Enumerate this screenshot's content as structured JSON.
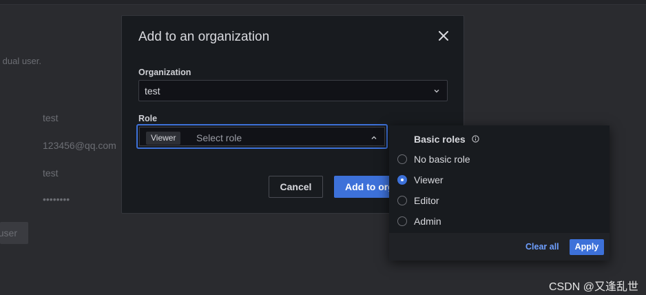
{
  "background": {
    "subtitle_fragment": "dual user.",
    "fields": [
      "test",
      "123456@qq.com",
      "test",
      "••••••••"
    ],
    "button_fragment": "user"
  },
  "modal": {
    "title": "Add to an organization",
    "organization": {
      "label": "Organization",
      "value": "test"
    },
    "role": {
      "label": "Role",
      "chip": "Viewer",
      "placeholder": "Select role"
    },
    "cancel_label": "Cancel",
    "add_label": "Add to organization"
  },
  "dropdown": {
    "header": "Basic roles",
    "options": [
      {
        "label": "No basic role",
        "checked": false
      },
      {
        "label": "Viewer",
        "checked": true
      },
      {
        "label": "Editor",
        "checked": false
      },
      {
        "label": "Admin",
        "checked": false
      }
    ],
    "clear_label": "Clear all",
    "apply_label": "Apply"
  },
  "watermark": "CSDN @又逢乱世",
  "colors": {
    "accent": "#3d71d9",
    "link": "#6e9fff",
    "panel": "#181b1f"
  }
}
